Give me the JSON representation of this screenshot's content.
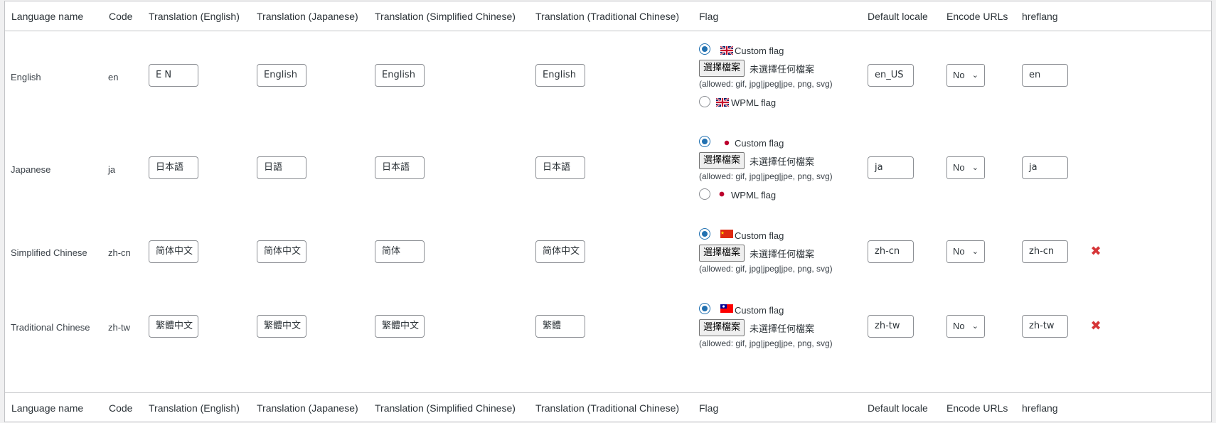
{
  "headers": {
    "language_name": "Language name",
    "code": "Code",
    "tr_en": "Translation (English)",
    "tr_ja": "Translation (Japanese)",
    "tr_zhs": "Translation (Simplified Chinese)",
    "tr_zht": "Translation (Traditional Chinese)",
    "flag": "Flag",
    "default_locale": "Default locale",
    "encode_urls": "Encode URLs",
    "hreflang": "hreflang"
  },
  "flag_ui": {
    "custom_flag": "Custom flag",
    "wpml_flag": "WPML flag",
    "choose_file": "選擇檔案",
    "no_file": "未選擇任何檔案",
    "allowed": "(allowed: gif, jpg|jpeg|jpe, png, svg)"
  },
  "colors": {
    "accent": "#2271b1",
    "delete": "#d63638",
    "border": "#c3c4c7"
  },
  "rows": [
    {
      "name": "English",
      "code": "en",
      "tr_en": "E N",
      "tr_ja": "English",
      "tr_zhs": "English",
      "tr_zht": "English",
      "flag_icon": "uk-flag-icon",
      "has_wpml": true,
      "locale": "en_US",
      "encode": "No",
      "hreflang": "en",
      "deletable": false
    },
    {
      "name": "Japanese",
      "code": "ja",
      "tr_en": "日本語",
      "tr_ja": "日語",
      "tr_zhs": "日本語",
      "tr_zht": "日本語",
      "flag_icon": "japan-flag-icon",
      "has_wpml": true,
      "locale": "ja",
      "encode": "No",
      "hreflang": "ja",
      "deletable": false
    },
    {
      "name": "Simplified Chinese",
      "code": "zh-cn",
      "tr_en": "简体中文",
      "tr_ja": "简体中文",
      "tr_zhs": "简体",
      "tr_zht": "简体中文",
      "flag_icon": "china-flag-icon",
      "has_wpml": false,
      "locale": "zh-cn",
      "encode": "No",
      "hreflang": "zh-cn",
      "deletable": true
    },
    {
      "name": "Traditional Chinese",
      "code": "zh-tw",
      "tr_en": "繁體中文",
      "tr_ja": "繁體中文",
      "tr_zhs": "繁體中文",
      "tr_zht": "繁體",
      "flag_icon": "taiwan-flag-icon",
      "has_wpml": false,
      "locale": "zh-tw",
      "encode": "No",
      "hreflang": "zh-tw",
      "deletable": true
    }
  ]
}
